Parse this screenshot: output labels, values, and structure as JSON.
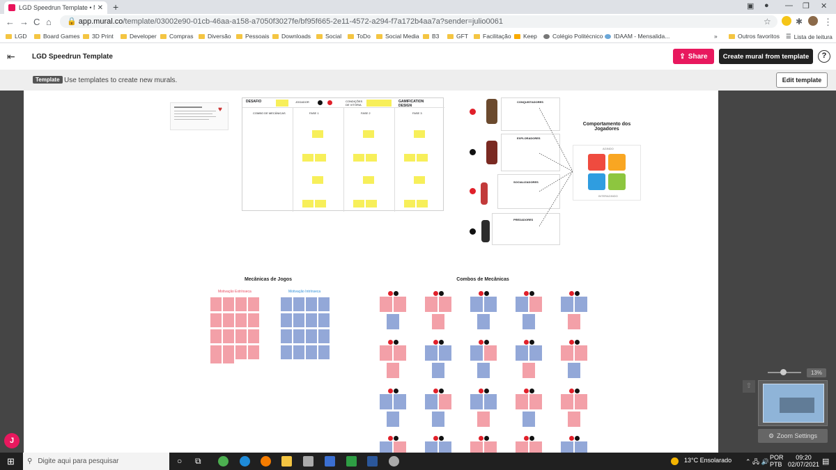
{
  "browser": {
    "tab_title": "LGD Speedrun Template • MURAL",
    "tab_close": "✕",
    "new_tab": "+",
    "url_host": "app.mural.co",
    "url_path": "/template/03002e90-01cb-46aa-a158-a7050f3027fe/bf95f665-2e11-4572-a294-f7a172b4aa7a?sender=julio0061",
    "bookmarks": [
      "LGD",
      "Board Games",
      "3D Print",
      "Developer",
      "Compras",
      "Diversão",
      "Pessoais",
      "Downloads",
      "Social",
      "ToDo",
      "Social Media",
      "B3",
      "GFT",
      "Facilitação",
      "Keep",
      "Colégio Politécnico",
      "IDAAM - Mensalida..."
    ],
    "bookmark_more": "»",
    "other_favorites": "Outros favoritos",
    "reading_list": "Lista de leitura"
  },
  "mural": {
    "title": "LGD Speedrun Template",
    "share_label": "Share",
    "create_label": "Create mural from template",
    "help": "?",
    "template_badge": "Template",
    "template_desc": "Use templates to create new murals.",
    "edit_label": "Edit template"
  },
  "canvas": {
    "title_comportamento": "Comportamento dos Jogadores",
    "title_mecanicas": "Mecânicas de Jogos",
    "title_combos": "Combos de Mecânicas",
    "label_extrinseca": "Motivação Extrínseca",
    "label_intrinseca": "Motivação Intrínseca",
    "desafio": "DESAFIO",
    "combo": "COMBO DE MECÂNICAS",
    "jogador": "JOGADOR",
    "condicoes": "CONDIÇÕES DE VITÓRIA",
    "gamification": "GAMIFICATION DESIGN",
    "fase1": "FASE 1",
    "fase2": "FASE 2",
    "fase3": "FASE 3",
    "conquistadores": "CONQUISTADORES",
    "exploradores": "EXPLORADORES",
    "socializadores": "SOCIALIZADORES",
    "predadores": "PREDADORES",
    "agindo": "AGINDO",
    "interagindo": "INTERAGINDO"
  },
  "zoom": {
    "percent": "13%",
    "settings_label": "Zoom Settings"
  },
  "avatar_letter": "J",
  "taskbar": {
    "search_placeholder": "Digite aqui para pesquisar",
    "weather": "13°C  Ensolarado",
    "lang": "POR",
    "layout": "PTB",
    "time": "09:20",
    "date": "02/07/2021"
  }
}
